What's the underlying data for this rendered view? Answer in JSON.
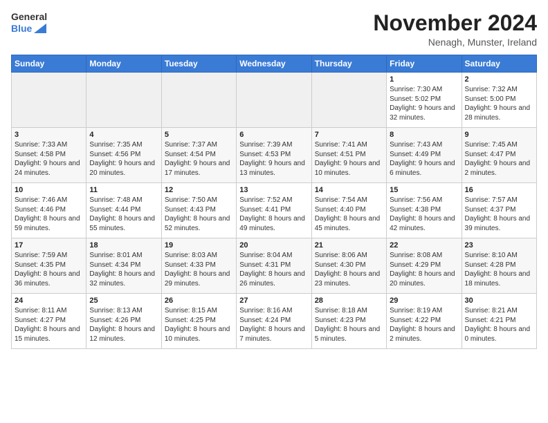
{
  "logo": {
    "text_general": "General",
    "text_blue": "Blue"
  },
  "title": "November 2024",
  "location": "Nenagh, Munster, Ireland",
  "days_of_week": [
    "Sunday",
    "Monday",
    "Tuesday",
    "Wednesday",
    "Thursday",
    "Friday",
    "Saturday"
  ],
  "weeks": [
    [
      {
        "day": "",
        "info": ""
      },
      {
        "day": "",
        "info": ""
      },
      {
        "day": "",
        "info": ""
      },
      {
        "day": "",
        "info": ""
      },
      {
        "day": "",
        "info": ""
      },
      {
        "day": "1",
        "info": "Sunrise: 7:30 AM\nSunset: 5:02 PM\nDaylight: 9 hours and 32 minutes."
      },
      {
        "day": "2",
        "info": "Sunrise: 7:32 AM\nSunset: 5:00 PM\nDaylight: 9 hours and 28 minutes."
      }
    ],
    [
      {
        "day": "3",
        "info": "Sunrise: 7:33 AM\nSunset: 4:58 PM\nDaylight: 9 hours and 24 minutes."
      },
      {
        "day": "4",
        "info": "Sunrise: 7:35 AM\nSunset: 4:56 PM\nDaylight: 9 hours and 20 minutes."
      },
      {
        "day": "5",
        "info": "Sunrise: 7:37 AM\nSunset: 4:54 PM\nDaylight: 9 hours and 17 minutes."
      },
      {
        "day": "6",
        "info": "Sunrise: 7:39 AM\nSunset: 4:53 PM\nDaylight: 9 hours and 13 minutes."
      },
      {
        "day": "7",
        "info": "Sunrise: 7:41 AM\nSunset: 4:51 PM\nDaylight: 9 hours and 10 minutes."
      },
      {
        "day": "8",
        "info": "Sunrise: 7:43 AM\nSunset: 4:49 PM\nDaylight: 9 hours and 6 minutes."
      },
      {
        "day": "9",
        "info": "Sunrise: 7:45 AM\nSunset: 4:47 PM\nDaylight: 9 hours and 2 minutes."
      }
    ],
    [
      {
        "day": "10",
        "info": "Sunrise: 7:46 AM\nSunset: 4:46 PM\nDaylight: 8 hours and 59 minutes."
      },
      {
        "day": "11",
        "info": "Sunrise: 7:48 AM\nSunset: 4:44 PM\nDaylight: 8 hours and 55 minutes."
      },
      {
        "day": "12",
        "info": "Sunrise: 7:50 AM\nSunset: 4:43 PM\nDaylight: 8 hours and 52 minutes."
      },
      {
        "day": "13",
        "info": "Sunrise: 7:52 AM\nSunset: 4:41 PM\nDaylight: 8 hours and 49 minutes."
      },
      {
        "day": "14",
        "info": "Sunrise: 7:54 AM\nSunset: 4:40 PM\nDaylight: 8 hours and 45 minutes."
      },
      {
        "day": "15",
        "info": "Sunrise: 7:56 AM\nSunset: 4:38 PM\nDaylight: 8 hours and 42 minutes."
      },
      {
        "day": "16",
        "info": "Sunrise: 7:57 AM\nSunset: 4:37 PM\nDaylight: 8 hours and 39 minutes."
      }
    ],
    [
      {
        "day": "17",
        "info": "Sunrise: 7:59 AM\nSunset: 4:35 PM\nDaylight: 8 hours and 36 minutes."
      },
      {
        "day": "18",
        "info": "Sunrise: 8:01 AM\nSunset: 4:34 PM\nDaylight: 8 hours and 32 minutes."
      },
      {
        "day": "19",
        "info": "Sunrise: 8:03 AM\nSunset: 4:33 PM\nDaylight: 8 hours and 29 minutes."
      },
      {
        "day": "20",
        "info": "Sunrise: 8:04 AM\nSunset: 4:31 PM\nDaylight: 8 hours and 26 minutes."
      },
      {
        "day": "21",
        "info": "Sunrise: 8:06 AM\nSunset: 4:30 PM\nDaylight: 8 hours and 23 minutes."
      },
      {
        "day": "22",
        "info": "Sunrise: 8:08 AM\nSunset: 4:29 PM\nDaylight: 8 hours and 20 minutes."
      },
      {
        "day": "23",
        "info": "Sunrise: 8:10 AM\nSunset: 4:28 PM\nDaylight: 8 hours and 18 minutes."
      }
    ],
    [
      {
        "day": "24",
        "info": "Sunrise: 8:11 AM\nSunset: 4:27 PM\nDaylight: 8 hours and 15 minutes."
      },
      {
        "day": "25",
        "info": "Sunrise: 8:13 AM\nSunset: 4:26 PM\nDaylight: 8 hours and 12 minutes."
      },
      {
        "day": "26",
        "info": "Sunrise: 8:15 AM\nSunset: 4:25 PM\nDaylight: 8 hours and 10 minutes."
      },
      {
        "day": "27",
        "info": "Sunrise: 8:16 AM\nSunset: 4:24 PM\nDaylight: 8 hours and 7 minutes."
      },
      {
        "day": "28",
        "info": "Sunrise: 8:18 AM\nSunset: 4:23 PM\nDaylight: 8 hours and 5 minutes."
      },
      {
        "day": "29",
        "info": "Sunrise: 8:19 AM\nSunset: 4:22 PM\nDaylight: 8 hours and 2 minutes."
      },
      {
        "day": "30",
        "info": "Sunrise: 8:21 AM\nSunset: 4:21 PM\nDaylight: 8 hours and 0 minutes."
      }
    ]
  ]
}
